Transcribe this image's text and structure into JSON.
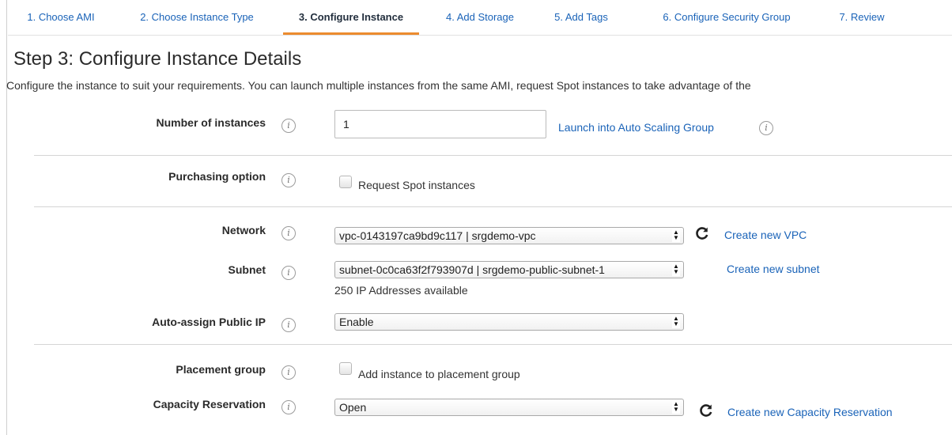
{
  "tabs": [
    {
      "label": "1. Choose AMI"
    },
    {
      "label": "2. Choose Instance Type"
    },
    {
      "label": "3. Configure Instance"
    },
    {
      "label": "4. Add Storage"
    },
    {
      "label": "5. Add Tags"
    },
    {
      "label": "6. Configure Security Group"
    },
    {
      "label": "7. Review"
    }
  ],
  "page": {
    "title": "Step 3: Configure Instance Details",
    "description": "Configure the instance to suit your requirements. You can launch multiple instances from the same AMI, request Spot instances to take advantage of the"
  },
  "info_icon_glyph": "i",
  "form": {
    "instances": {
      "label": "Number of instances",
      "value": "1",
      "link": "Launch into Auto Scaling Group"
    },
    "purchasing": {
      "label": "Purchasing option",
      "checkbox_label": "Request Spot instances"
    },
    "network": {
      "label": "Network",
      "value": "vpc-0143197ca9bd9c117 | srgdemo-vpc",
      "link": "Create new VPC"
    },
    "subnet": {
      "label": "Subnet",
      "value": "subnet-0c0ca63f2f793907d | srgdemo-public-subnet-1",
      "link": "Create new subnet",
      "note": "250 IP Addresses available"
    },
    "public_ip": {
      "label": "Auto-assign Public IP",
      "value": "Enable"
    },
    "placement": {
      "label": "Placement group",
      "checkbox_label": "Add instance to placement group"
    },
    "capacity": {
      "label": "Capacity Reservation",
      "value": "Open",
      "link": "Create new Capacity Reservation"
    }
  },
  "colors": {
    "link": "#1a63b8",
    "active_tab_underline": "#ec8b2f"
  }
}
